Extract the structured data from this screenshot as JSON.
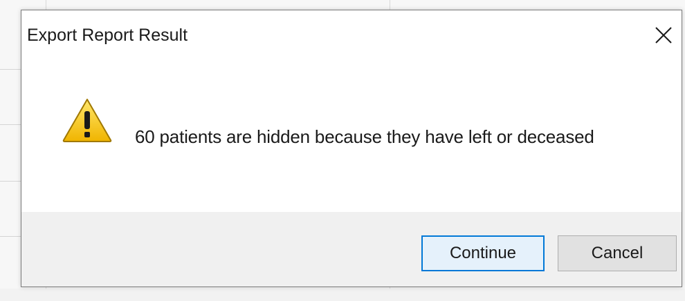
{
  "dialog": {
    "title": "Export Report Result",
    "message": "60 patients are hidden because they have left or deceased",
    "icon": "warning-icon",
    "buttons": {
      "continue_label": "Continue",
      "cancel_label": "Cancel"
    },
    "close_icon": "close-icon"
  },
  "colors": {
    "accent": "#0078d7",
    "footer_bg": "#f0f0f0",
    "warning_yellow": "#f5c400"
  }
}
